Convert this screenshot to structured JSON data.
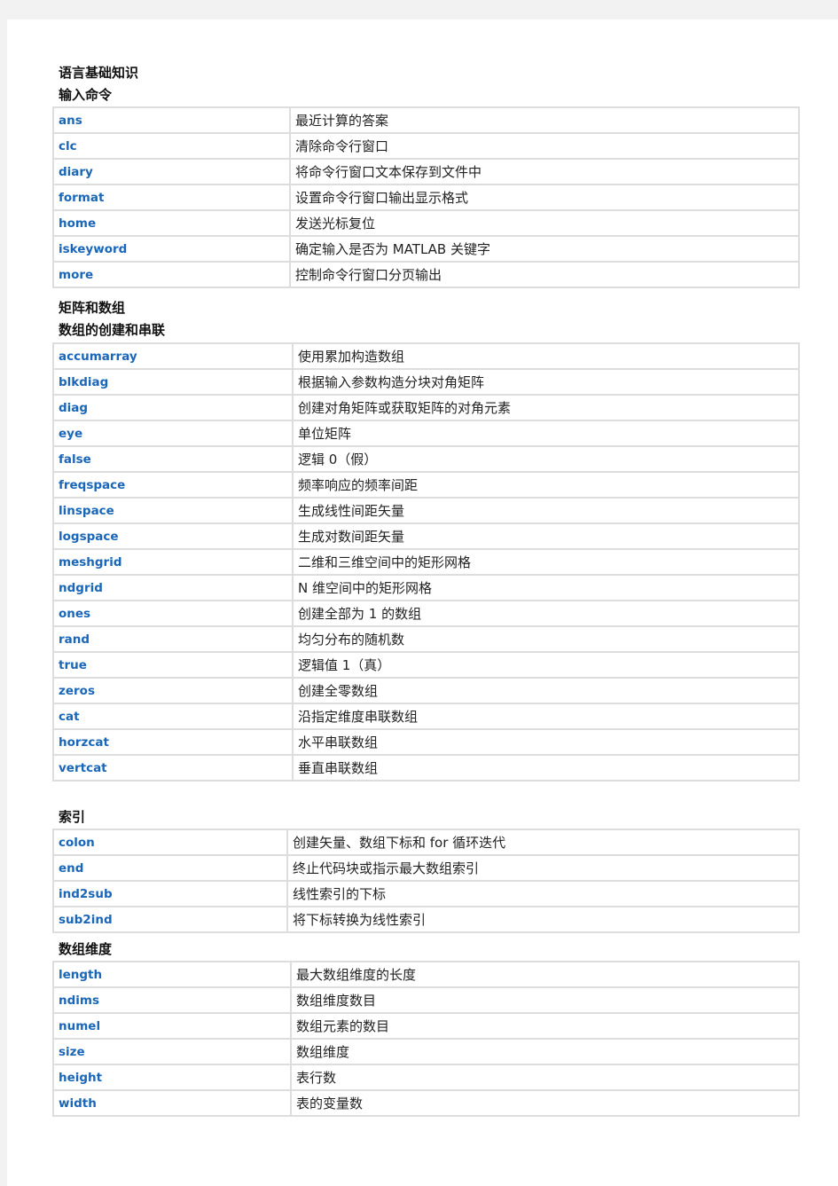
{
  "title": "语言基础知识",
  "sections": [
    {
      "heading": "输入命令",
      "rows": [
        [
          "ans",
          "最近计算的答案"
        ],
        [
          "clc",
          "清除命令行窗口"
        ],
        [
          "diary",
          "将命令行窗口文本保存到文件中"
        ],
        [
          "format",
          "设置命令行窗口输出显示格式"
        ],
        [
          "home",
          "发送光标复位"
        ],
        [
          "iskeyword",
          "确定输入是否为 MATLAB 关键字"
        ],
        [
          "more",
          "控制命令行窗口分页输出"
        ]
      ]
    },
    {
      "group": "矩阵和数组",
      "heading": "数组的创建和串联",
      "rows": [
        [
          "accumarray",
          "使用累加构造数组"
        ],
        [
          "blkdiag",
          "根据输入参数构造分块对角矩阵"
        ],
        [
          "diag",
          "创建对角矩阵或获取矩阵的对角元素"
        ],
        [
          "eye",
          "单位矩阵"
        ],
        [
          "false",
          "逻辑 0（假）"
        ],
        [
          "freqspace",
          "频率响应的频率间距"
        ],
        [
          "linspace",
          "生成线性间距矢量"
        ],
        [
          "logspace",
          "生成对数间距矢量"
        ],
        [
          "meshgrid",
          "二维和三维空间中的矩形网格"
        ],
        [
          "ndgrid",
          "N 维空间中的矩形网格"
        ],
        [
          "ones",
          "创建全部为 1 的数组"
        ],
        [
          "rand",
          "均匀分布的随机数"
        ],
        [
          "true",
          "逻辑值 1（真）"
        ],
        [
          "zeros",
          "创建全零数组"
        ],
        [
          "cat",
          "沿指定维度串联数组"
        ],
        [
          "horzcat",
          "水平串联数组"
        ],
        [
          "vertcat",
          "垂直串联数组"
        ]
      ]
    },
    {
      "heading": "索引",
      "rows": [
        [
          "colon",
          "创建矢量、数组下标和 for 循环迭代"
        ],
        [
          "end",
          "终止代码块或指示最大数组索引"
        ],
        [
          "ind2sub",
          "线性索引的下标"
        ],
        [
          "sub2ind",
          "将下标转换为线性索引"
        ]
      ]
    },
    {
      "heading": "数组维度",
      "rows": [
        [
          "length",
          "最大数组维度的长度"
        ],
        [
          "ndims",
          "数组维度数目"
        ],
        [
          "numel",
          "数组元素的数目"
        ],
        [
          "size",
          "数组维度"
        ],
        [
          "height",
          "表行数"
        ],
        [
          "width",
          "表的变量数"
        ]
      ]
    }
  ]
}
